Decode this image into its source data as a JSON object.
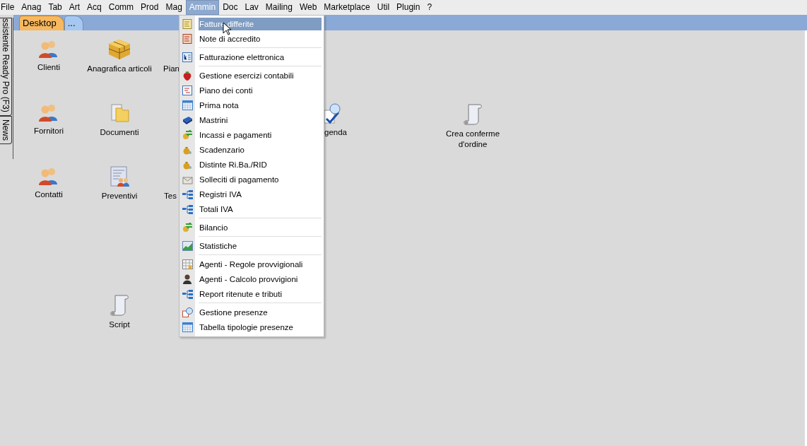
{
  "menubar": [
    {
      "label": "File",
      "selected": false
    },
    {
      "label": "Anag",
      "selected": false
    },
    {
      "label": "Tab",
      "selected": false
    },
    {
      "label": "Art",
      "selected": false
    },
    {
      "label": "Acq",
      "selected": false
    },
    {
      "label": "Comm",
      "selected": false
    },
    {
      "label": "Prod",
      "selected": false
    },
    {
      "label": "Mag",
      "selected": false
    },
    {
      "label": "Ammin",
      "selected": true
    },
    {
      "label": "Doc",
      "selected": false
    },
    {
      "label": "Lav",
      "selected": false
    },
    {
      "label": "Mailing",
      "selected": false
    },
    {
      "label": "Web",
      "selected": false
    },
    {
      "label": "Marketplace",
      "selected": false
    },
    {
      "label": "Util",
      "selected": false
    },
    {
      "label": "Plugin",
      "selected": false
    },
    {
      "label": "?",
      "selected": false
    }
  ],
  "tabs": [
    {
      "label": "Desktop",
      "selected": true
    },
    {
      "label": "...",
      "selected": false
    }
  ],
  "side_tabs": [
    {
      "label": "ssistente Ready Pro (F3)"
    },
    {
      "label": "News"
    }
  ],
  "desktop": [
    {
      "label": "Clienti"
    },
    {
      "label": "Anagrafica articoli"
    },
    {
      "label": "Pian"
    },
    {
      "label": "Fornitori"
    },
    {
      "label": "Documenti"
    },
    {
      "label": "genda"
    },
    {
      "label": "Crea conferme d'ordine"
    },
    {
      "label": "Contatti"
    },
    {
      "label": "Preventivi"
    },
    {
      "label": "Tes"
    },
    {
      "label": "Script"
    }
  ],
  "menu": [
    {
      "kind": "item",
      "label": "Fatture differite",
      "selected": true
    },
    {
      "kind": "item",
      "label": "Note di accredito",
      "selected": false
    },
    {
      "kind": "separator"
    },
    {
      "kind": "item",
      "label": "Fatturazione elettronica",
      "selected": false
    },
    {
      "kind": "separator"
    },
    {
      "kind": "item",
      "label": "Gestione esercizi contabili",
      "selected": false
    },
    {
      "kind": "item",
      "label": "Piano dei conti",
      "selected": false
    },
    {
      "kind": "item",
      "label": "Prima nota",
      "selected": false
    },
    {
      "kind": "item",
      "label": "Mastrini",
      "selected": false
    },
    {
      "kind": "item",
      "label": "Incassi e pagamenti",
      "selected": false
    },
    {
      "kind": "item",
      "label": "Scadenzario",
      "selected": false
    },
    {
      "kind": "item",
      "label": "Distinte Ri.Ba./RID",
      "selected": false
    },
    {
      "kind": "item",
      "label": "Solleciti di pagamento",
      "selected": false
    },
    {
      "kind": "item",
      "label": "Registri IVA",
      "selected": false
    },
    {
      "kind": "item",
      "label": "Totali IVA",
      "selected": false
    },
    {
      "kind": "separator"
    },
    {
      "kind": "item",
      "label": "Bilancio",
      "selected": false
    },
    {
      "kind": "separator"
    },
    {
      "kind": "item",
      "label": "Statistiche",
      "selected": false
    },
    {
      "kind": "separator"
    },
    {
      "kind": "item",
      "label": "Agenti - Regole provvigionali",
      "selected": false
    },
    {
      "kind": "item",
      "label": "Agenti - Calcolo provvigioni",
      "selected": false
    },
    {
      "kind": "item",
      "label": "Report ritenute e tributi",
      "selected": false
    },
    {
      "kind": "separator"
    },
    {
      "kind": "item",
      "label": "Gestione presenze",
      "selected": false
    },
    {
      "kind": "item",
      "label": "Tabella tipologie presenze",
      "selected": false
    }
  ]
}
